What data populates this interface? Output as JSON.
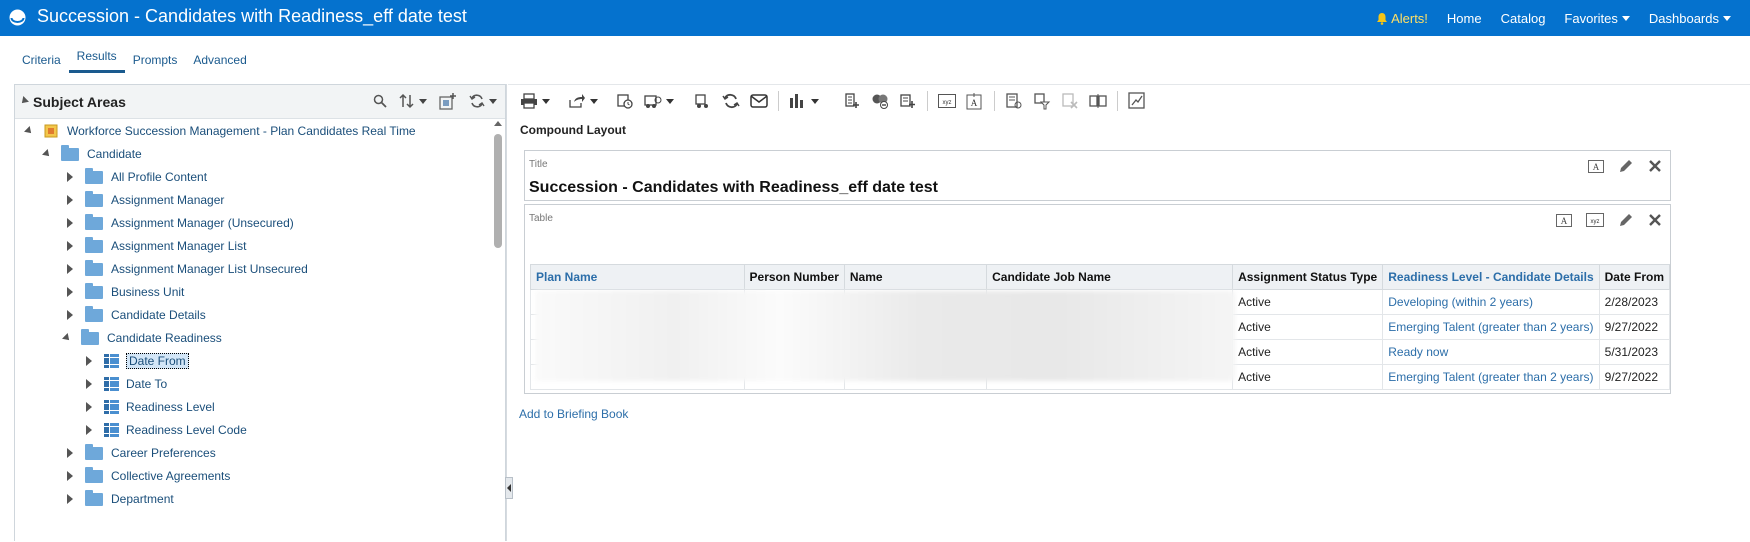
{
  "header": {
    "title": "Succession - Candidates with Readiness_eff date test",
    "nav": {
      "alerts": "Alerts!",
      "home": "Home",
      "catalog": "Catalog",
      "favorites": "Favorites",
      "dashboards": "Dashboards"
    }
  },
  "tabs": [
    {
      "label": "Criteria",
      "active": false
    },
    {
      "label": "Results",
      "active": true
    },
    {
      "label": "Prompts",
      "active": false
    },
    {
      "label": "Advanced",
      "active": false
    }
  ],
  "subject_areas": {
    "title": "Subject Areas",
    "tree": [
      {
        "label": "Workforce Succession Management - Plan Candidates Real Time",
        "type": "subject-area",
        "expanded": true
      },
      {
        "label": "Candidate",
        "type": "folder",
        "expanded": true
      },
      {
        "label": "All Profile Content",
        "type": "folder",
        "expanded": false
      },
      {
        "label": "Assignment Manager",
        "type": "folder",
        "expanded": false
      },
      {
        "label": "Assignment Manager (Unsecured)",
        "type": "folder",
        "expanded": false
      },
      {
        "label": "Assignment Manager List",
        "type": "folder",
        "expanded": false
      },
      {
        "label": "Assignment Manager List Unsecured",
        "type": "folder",
        "expanded": false
      },
      {
        "label": "Business Unit",
        "type": "folder",
        "expanded": false
      },
      {
        "label": "Candidate Details",
        "type": "folder",
        "expanded": false
      },
      {
        "label": "Candidate Readiness",
        "type": "folder",
        "expanded": true
      },
      {
        "label": "Date From",
        "type": "column",
        "selected": true
      },
      {
        "label": "Date To",
        "type": "column",
        "selected": false
      },
      {
        "label": "Readiness Level",
        "type": "column",
        "selected": false
      },
      {
        "label": "Readiness Level Code",
        "type": "column",
        "selected": false
      },
      {
        "label": "Career Preferences",
        "type": "folder",
        "expanded": false
      },
      {
        "label": "Collective Agreements",
        "type": "folder",
        "expanded": false
      },
      {
        "label": "Department",
        "type": "folder",
        "expanded": false
      }
    ]
  },
  "editor": {
    "compound_layout": "Compound Layout",
    "title_view": {
      "label": "Title",
      "text": "Succession - Candidates with Readiness_eff date test"
    },
    "table_view": {
      "label": "Table",
      "columns": [
        "Plan Name",
        "Person Number",
        "Name",
        "Candidate Job Name",
        "Assignment Status Type",
        "Readiness Level - Candidate Details",
        "Date From"
      ],
      "rows": [
        [
          "",
          "",
          "",
          "",
          "Active",
          "Developing (within 2 years)",
          "2/28/2023"
        ],
        [
          "",
          "",
          "",
          "",
          "Active",
          "Emerging Talent (greater than 2 years)",
          "9/27/2022"
        ],
        [
          "",
          "",
          "",
          "",
          "Active",
          "Ready now",
          "5/31/2023"
        ],
        [
          "",
          "",
          "",
          "",
          "Active",
          "Emerging Talent (greater than 2 years)",
          "9/27/2022"
        ]
      ]
    },
    "add_to_briefing_book": "Add to Briefing Book"
  },
  "colors": {
    "header_bg": "#0572ce",
    "link": "#2c6ea9",
    "alerts": "#ffe066"
  }
}
